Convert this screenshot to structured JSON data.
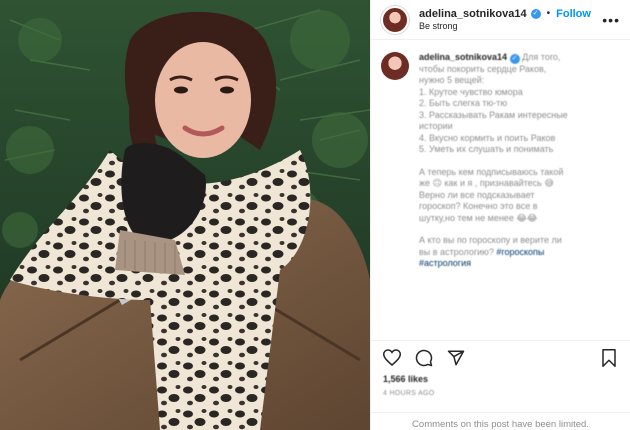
{
  "header": {
    "username": "adelina_sotnikova14",
    "verified": "✓",
    "separator": "•",
    "follow_label": "Follow",
    "subtitle": "Be strong",
    "more_label": "•••"
  },
  "caption": {
    "username": "adelina_sotnikova14",
    "lines": [
      "Для того,",
      "чтобы покорить сердце Раков,",
      "нужно 5 вещей:",
      "1. Крутое чувство юмора",
      "2. Быть слегка тю-тю",
      "3. Рассказывать Ракам интересные",
      "истории",
      "4. Вкусно кормить и поить Раков",
      "5. Уметь их слушать и понимать",
      "",
      "А теперь кем подписываюсь такой",
      "же 🙃 как и я , признавайтесь 😅",
      "Верно ли все подсказывает",
      "гороскоп? Конечно это все в",
      "шутку,но тем не менее 😂😂",
      "",
      "А кто вы по гороскопу и верите ли",
      "вы в астрологию? #гороскопы",
      "#астрология"
    ],
    "tags": [
      "#гороскопы",
      "#астрология"
    ]
  },
  "actions": {
    "like_icon": "heart-icon",
    "comment_icon": "comment-icon",
    "share_icon": "share-icon",
    "save_icon": "bookmark-icon"
  },
  "likes_text": "1,566 likes",
  "time_text": "4 HOURS AGO",
  "comments_disabled_text": "Comments on this post have been limited."
}
